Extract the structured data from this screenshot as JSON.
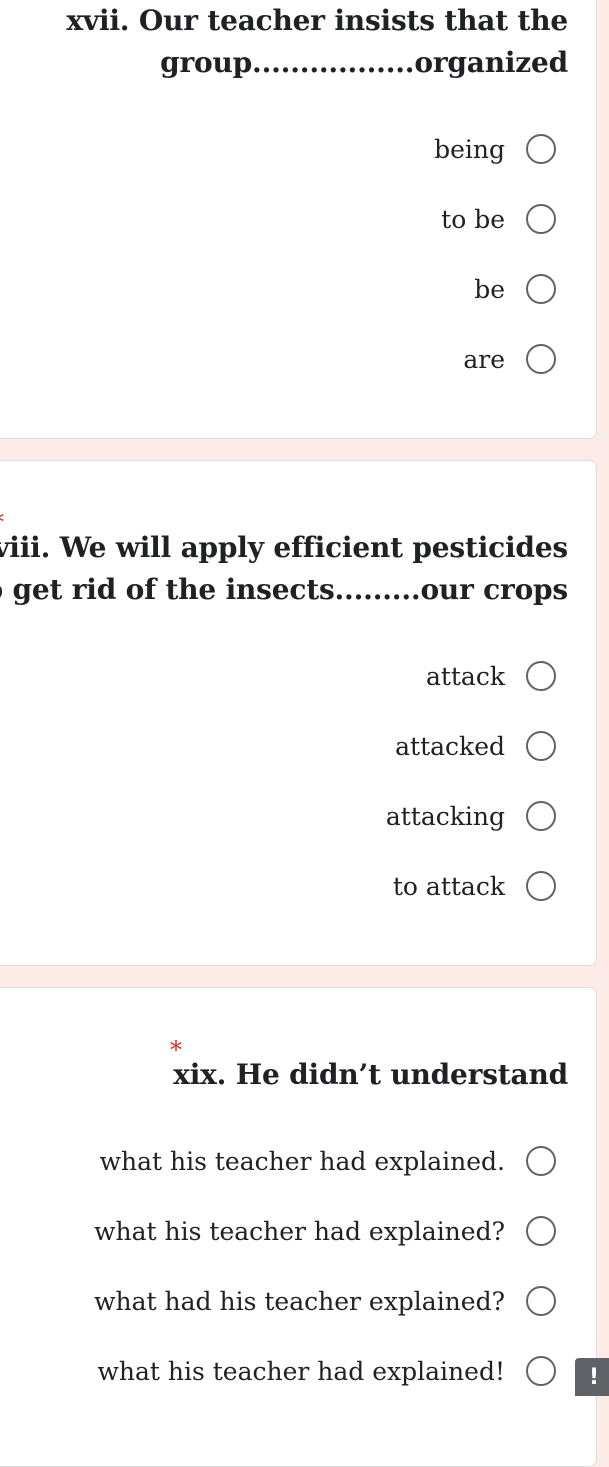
{
  "questions": [
    {
      "title_line1": "xvii. Our teacher insists that the",
      "title_line2": "group.................organized",
      "options": [
        "being",
        "to be",
        "be",
        "are"
      ]
    },
    {
      "required_mark": "*",
      "title_line1": "xviii. We will apply efficient pesticides",
      "title_line2": "to get rid of the insects.........our crops",
      "options": [
        "attack",
        "attacked",
        "attacking",
        "to attack"
      ]
    },
    {
      "required_mark": "*",
      "title_line1": "xix.  He didn’t understand",
      "options": [
        "what his teacher had explained.",
        "what his teacher had explained?",
        "what had his teacher explained?",
        "what his teacher had explained!"
      ]
    }
  ],
  "report_button": {
    "icon": "exclamation-icon",
    "label": "!"
  },
  "colors": {
    "background": "#fcebe6",
    "card": "#ffffff",
    "required": "#d93025",
    "radio_border": "#5f6368"
  }
}
